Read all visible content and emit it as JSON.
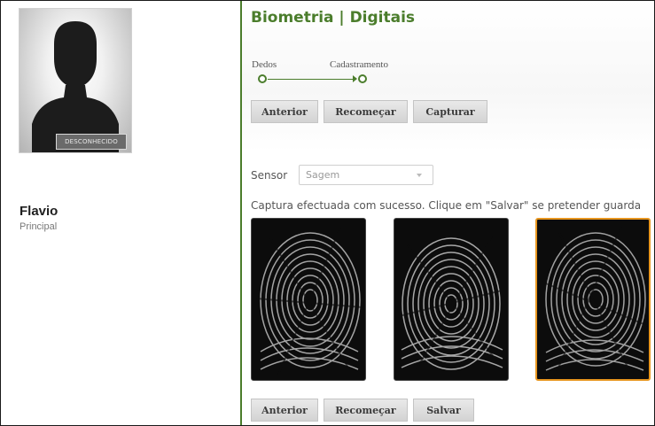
{
  "profile": {
    "status_badge": "DESCONHECIDO",
    "name": "Flavio",
    "role": "Principal"
  },
  "header": {
    "title": "Biometria | Digitais"
  },
  "wizard": {
    "steps": [
      "Dedos",
      "Cadastramento"
    ]
  },
  "top_buttons": {
    "previous": "Anterior",
    "restart": "Recomeçar",
    "capture": "Capturar"
  },
  "sensor": {
    "label": "Sensor",
    "value": "Sagem"
  },
  "capture_message": "Captura efectuada com sucesso. Clique em \"Salvar\" se pretender guarda",
  "fingerprints": [
    {
      "name": "fingerprint-1",
      "selected": false
    },
    {
      "name": "fingerprint-2",
      "selected": false
    },
    {
      "name": "fingerprint-3",
      "selected": true
    }
  ],
  "bottom_buttons": {
    "previous": "Anterior",
    "restart": "Recomeçar",
    "save": "Salvar"
  },
  "colors": {
    "accent": "#4b7d2c",
    "selected_border": "#e8961f"
  }
}
